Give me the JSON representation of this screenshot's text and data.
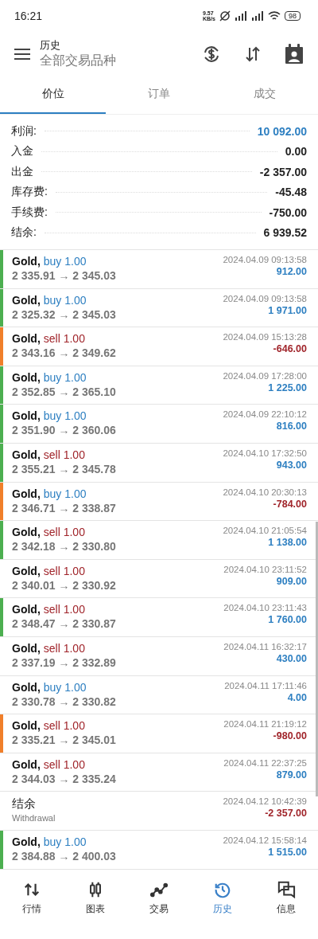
{
  "status_bar": {
    "time": "16:21",
    "speed": "9.57 KB/s",
    "battery": "98"
  },
  "header": {
    "title": "历史",
    "subtitle": "全部交易品种"
  },
  "tabs": [
    {
      "label": "价位",
      "selected": true
    },
    {
      "label": "订单",
      "selected": false
    },
    {
      "label": "成交",
      "selected": false
    }
  ],
  "summary": [
    {
      "label": "利润:",
      "value": "10 092.00",
      "highlight": true
    },
    {
      "label": "入金",
      "value": "0.00",
      "highlight": false
    },
    {
      "label": "出金",
      "value": "-2 357.00",
      "highlight": false
    },
    {
      "label": "库存费:",
      "value": "-45.48",
      "highlight": false
    },
    {
      "label": "手续费:",
      "value": "-750.00",
      "highlight": false
    },
    {
      "label": "结余:",
      "value": "6 939.52",
      "highlight": false
    }
  ],
  "deals": [
    {
      "kind": "buy",
      "symbol": "Gold,",
      "order": "buy 1.00",
      "prices": "2 335.91 → 2 345.03",
      "time": "2024.04.09 09:13:58",
      "profit": "912.00",
      "loss": false,
      "color": "#4caf50"
    },
    {
      "kind": "buy",
      "symbol": "Gold,",
      "order": "buy 1.00",
      "prices": "2 325.32 → 2 345.03",
      "time": "2024.04.09 09:13:58",
      "profit": "1 971.00",
      "loss": false,
      "color": "#4caf50"
    },
    {
      "kind": "sell",
      "symbol": "Gold,",
      "order": "sell 1.00",
      "prices": "2 343.16 → 2 349.62",
      "time": "2024.04.09 15:13:28",
      "profit": "-646.00",
      "loss": true,
      "color": "#f07f2a"
    },
    {
      "kind": "buy",
      "symbol": "Gold,",
      "order": "buy 1.00",
      "prices": "2 352.85 → 2 365.10",
      "time": "2024.04.09 17:28:00",
      "profit": "1 225.00",
      "loss": false,
      "color": "#4caf50"
    },
    {
      "kind": "buy",
      "symbol": "Gold,",
      "order": "buy 1.00",
      "prices": "2 351.90 → 2 360.06",
      "time": "2024.04.09 22:10:12",
      "profit": "816.00",
      "loss": false,
      "color": "#4caf50"
    },
    {
      "kind": "sell",
      "symbol": "Gold,",
      "order": "sell 1.00",
      "prices": "2 355.21 → 2 345.78",
      "time": "2024.04.10 17:32:50",
      "profit": "943.00",
      "loss": false,
      "color": "#4caf50"
    },
    {
      "kind": "buy",
      "symbol": "Gold,",
      "order": "buy 1.00",
      "prices": "2 346.71 → 2 338.87",
      "time": "2024.04.10 20:30:13",
      "profit": "-784.00",
      "loss": true,
      "color": "#f07f2a"
    },
    {
      "kind": "sell",
      "symbol": "Gold,",
      "order": "sell 1.00",
      "prices": "2 342.18 → 2 330.80",
      "time": "2024.04.10 21:05:54",
      "profit": "1 138.00",
      "loss": false,
      "color": "#4caf50"
    },
    {
      "kind": "sell",
      "symbol": "Gold,",
      "order": "sell 1.00",
      "prices": "2 340.01 → 2 330.92",
      "time": "2024.04.10 23:11:52",
      "profit": "909.00",
      "loss": false
    },
    {
      "kind": "sell",
      "symbol": "Gold,",
      "order": "sell 1.00",
      "prices": "2 348.47 → 2 330.87",
      "time": "2024.04.10 23:11:43",
      "profit": "1 760.00",
      "loss": false,
      "color": "#4caf50"
    },
    {
      "kind": "sell",
      "symbol": "Gold,",
      "order": "sell 1.00",
      "prices": "2 337.19 → 2 332.89",
      "time": "2024.04.11 16:32:17",
      "profit": "430.00",
      "loss": false
    },
    {
      "kind": "buy",
      "symbol": "Gold,",
      "order": "buy 1.00",
      "prices": "2 330.78 → 2 330.82",
      "time": "2024.04.11 17:11:46",
      "profit": "4.00",
      "loss": false
    },
    {
      "kind": "sell",
      "symbol": "Gold,",
      "order": "sell 1.00",
      "prices": "2 335.21 → 2 345.01",
      "time": "2024.04.11 21:19:12",
      "profit": "-980.00",
      "loss": true,
      "color": "#f07f2a"
    },
    {
      "kind": "sell",
      "symbol": "Gold,",
      "order": "sell 1.00",
      "prices": "2 344.03 → 2 335.24",
      "time": "2024.04.11 22:37:25",
      "profit": "879.00",
      "loss": false
    },
    {
      "kind": "balance",
      "title": "结余",
      "comment": "Withdrawal",
      "time": "2024.04.12 10:42:39",
      "profit": "-2 357.00",
      "loss": true
    },
    {
      "kind": "buy",
      "symbol": "Gold,",
      "order": "buy 1.00",
      "prices": "2 384.88 → 2 400.03",
      "time": "2024.04.12 15:58:14",
      "profit": "1 515.00",
      "loss": false,
      "color": "#4caf50"
    }
  ],
  "bottom_nav": [
    {
      "label": "行情",
      "kind": "arrows",
      "selected": false
    },
    {
      "label": "图表",
      "kind": "candles",
      "selected": false
    },
    {
      "label": "交易",
      "kind": "trend",
      "selected": false
    },
    {
      "label": "历史",
      "kind": "history",
      "selected": true
    },
    {
      "label": "信息",
      "kind": "chat",
      "selected": false
    }
  ]
}
